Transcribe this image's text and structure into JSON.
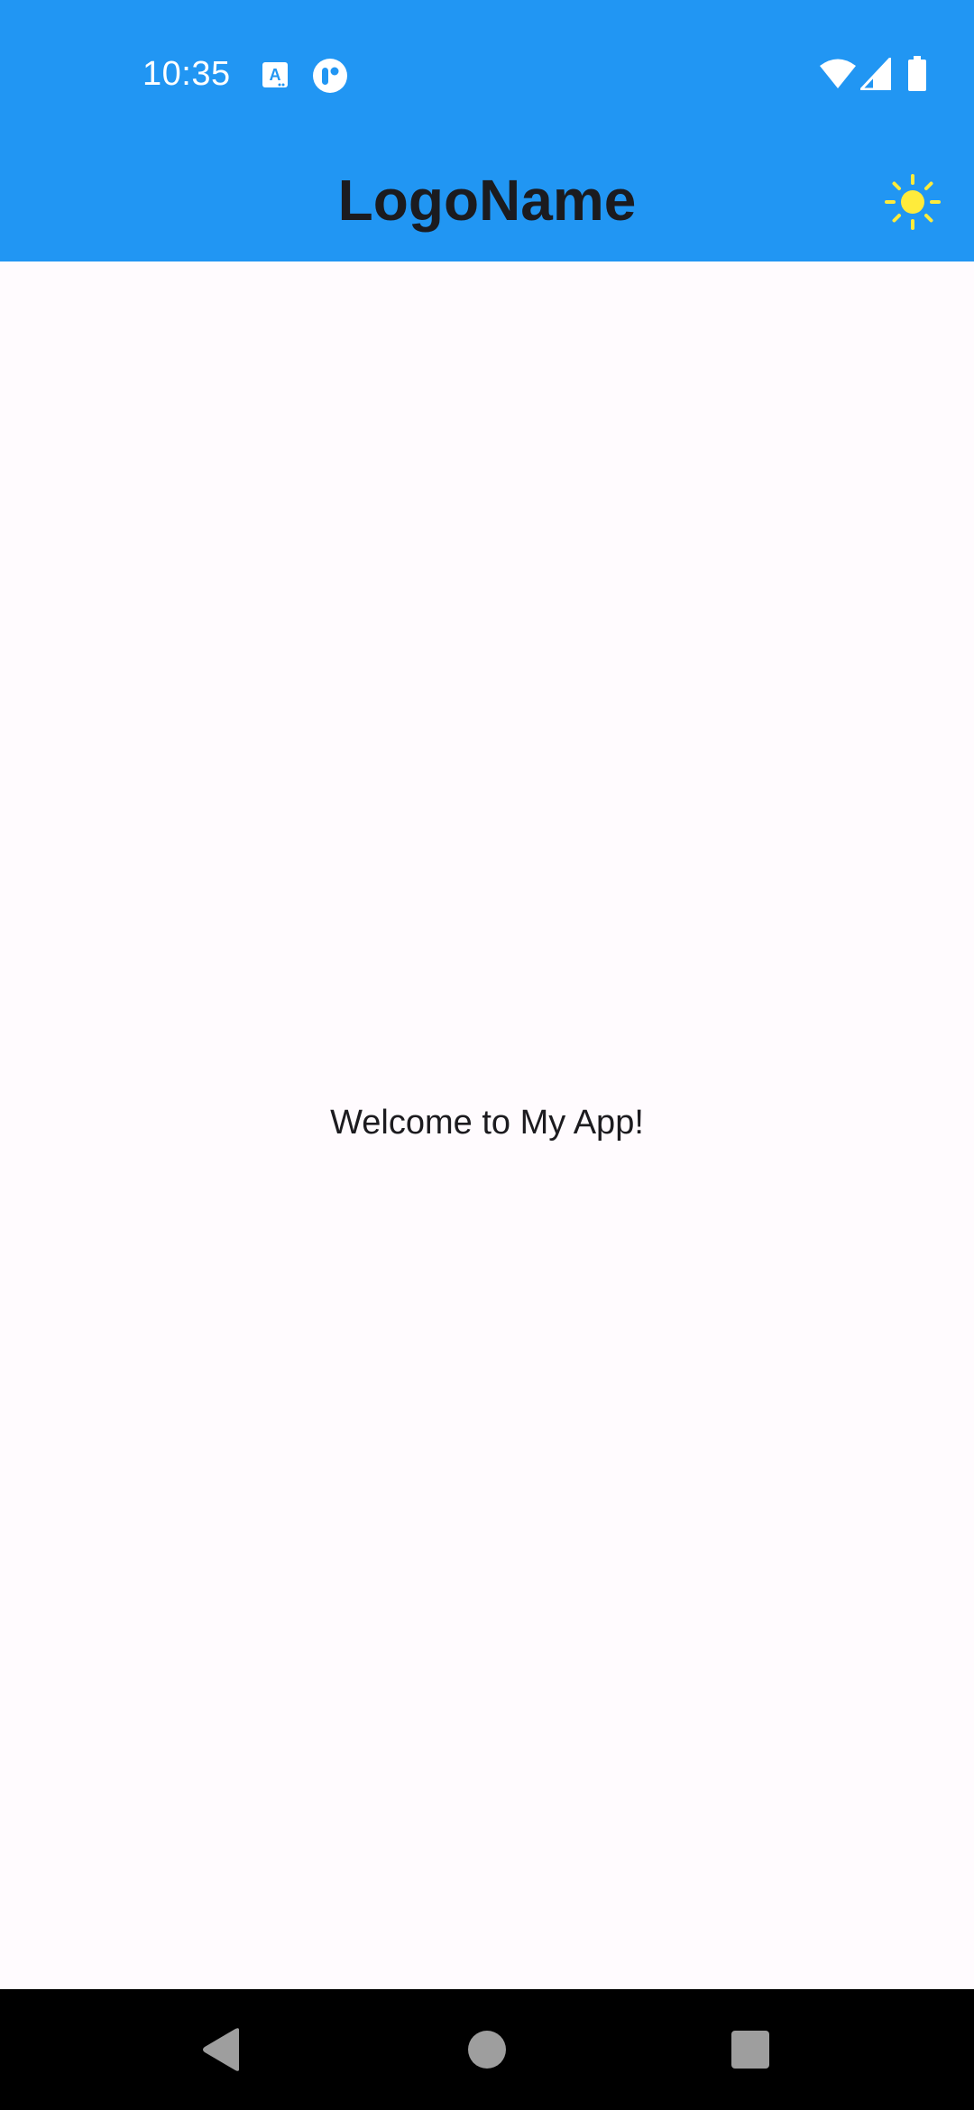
{
  "status_bar": {
    "time": "10:35",
    "notification_icons": [
      "translate-icon",
      "app-notification-icon"
    ],
    "system_icons": [
      "wifi-icon",
      "cell-signal-icon",
      "battery-icon"
    ],
    "background_color": "#2196f3"
  },
  "app_bar": {
    "title": "LogoName",
    "theme_toggle_icon": "sun-icon",
    "icon_color": "#ffeb3b",
    "background_color": "#2196f3"
  },
  "main": {
    "welcome_text": "Welcome to My App!"
  },
  "navigation_bar": {
    "buttons": [
      "back-icon",
      "home-icon",
      "recents-icon"
    ]
  }
}
